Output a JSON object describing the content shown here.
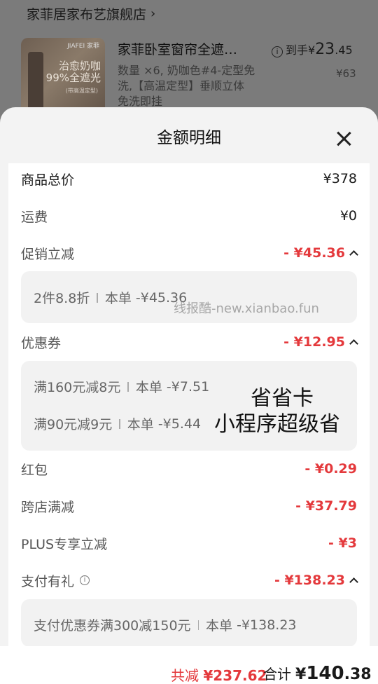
{
  "background": {
    "shop_name": "家菲居家布艺旗舰店",
    "product_title": "家菲卧室窗帘全遮…",
    "product_spec": "数量 ×6, 奶咖色#4-定型免洗,【高温定型】垂顺立体 免洗即挂",
    "thumb_brand": "JIAFEI 家菲",
    "thumb_line1": "治愈奶咖",
    "thumb_line2": "99%全遮光",
    "thumb_line3": "(带高温定型)",
    "price_prefix": "到手¥",
    "price_int": "23",
    "price_dec": ".45",
    "original_price": "¥63"
  },
  "sheet": {
    "title": "金额明细",
    "rows": {
      "goods_total": {
        "label": "商品总价",
        "value": "¥378"
      },
      "shipping": {
        "label": "运费",
        "value": "¥0"
      },
      "promo": {
        "label": "促销立减",
        "value": "- ¥45.36"
      },
      "promo_detail": {
        "name": "2件8.8折",
        "scope": "本单",
        "amount": "-¥45.36"
      },
      "coupon": {
        "label": "优惠券",
        "value": "- ¥12.95"
      },
      "coupon_detail_1": {
        "name": "满160元减8元",
        "scope": "本单",
        "amount": "-¥7.51"
      },
      "coupon_detail_2": {
        "name": "满90元减9元",
        "scope": "本单",
        "amount": "-¥5.44"
      },
      "red_packet": {
        "label": "红包",
        "value": "- ¥0.29"
      },
      "cross_store": {
        "label": "跨店满减",
        "value": "- ¥37.79"
      },
      "plus": {
        "label": "PLUS专享立减",
        "value": "- ¥3"
      },
      "payment": {
        "label": "支付有礼",
        "value": "- ¥138.23"
      },
      "payment_detail": {
        "name": "支付优惠券满300减150元",
        "scope": "本单",
        "amount": "-¥138.23"
      }
    }
  },
  "watermarks": {
    "site": "线报酷-new.xianbao.fun",
    "line1": "省省卡",
    "line2": "小程序超级省"
  },
  "footer": {
    "total_cut_label": "共减",
    "total_cut_value": "¥237.62",
    "sum_label": "合计",
    "sum_currency": "¥",
    "sum_int": "140",
    "sum_dec": ".38"
  },
  "colors": {
    "accent_red": "#e4393c"
  }
}
